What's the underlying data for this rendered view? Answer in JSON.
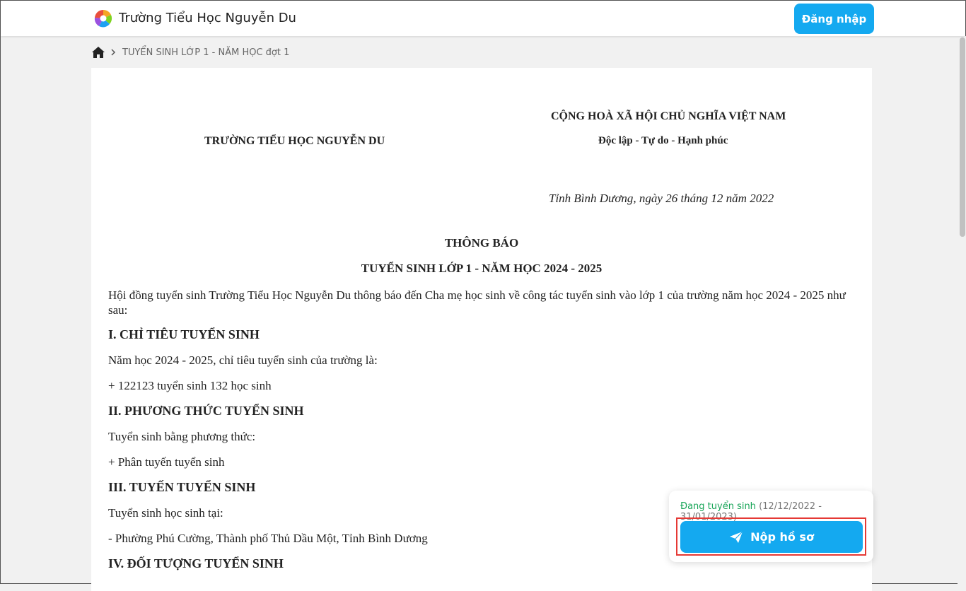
{
  "header": {
    "brand": "Trường Tiểu Học Nguyễn Du",
    "login_label": "Đăng nhập"
  },
  "breadcrumb": {
    "current": "TUYỂN SINH LỚP 1 - NĂM HỌC đợt 1"
  },
  "document": {
    "school": "TRƯỜNG TIỂU HỌC NGUYỄN DU",
    "country": "CỘNG HOÀ XÃ HỘI CHỦ NGHĨA VIỆT NAM",
    "motto": "Độc lập - Tự do - Hạnh phúc",
    "place_date": "Tỉnh Bình Dương, ngày 26 tháng 12 năm 2022",
    "title": "THÔNG BÁO",
    "subtitle": "TUYỂN SINH LỚP 1 - NĂM HỌC 2024 - 2025",
    "intro": "Hội đồng tuyển sinh Trường Tiểu Học Nguyễn Du thông báo đến Cha mẹ học sinh về công tác tuyển sinh vào lớp 1 của trường năm học 2024 - 2025 như sau:",
    "s1_heading": "I. CHỈ TIÊU TUYỂN SINH",
    "s1_p1": "Năm học 2024 - 2025, chỉ tiêu tuyển sinh của trường là:",
    "s1_p2": "+ 122123 tuyển sinh 132 học sinh",
    "s2_heading": "II. PHƯƠNG THỨC TUYỂN SINH",
    "s2_p1": "Tuyển sinh bằng phương thức:",
    "s2_p2": "+ Phân tuyến tuyển sinh",
    "s3_heading": "III. TUYẾN TUYỂN SINH",
    "s3_p1": "Tuyển sinh học sinh tại:",
    "s3_p2": "- Phường Phú Cường, Thành phố Thủ Dầu Một, Tỉnh Bình Dương",
    "s4_heading": "IV. ĐỐI TƯỢNG TUYỂN SINH"
  },
  "admission_card": {
    "status": "Đang tuyển sinh",
    "period": "(12/12/2022 - 31/01/2023)",
    "submit_label": "Nộp hồ sơ"
  },
  "colors": {
    "accent": "#14a9f0",
    "status_green": "#18a558",
    "highlight_red": "#e53935"
  }
}
